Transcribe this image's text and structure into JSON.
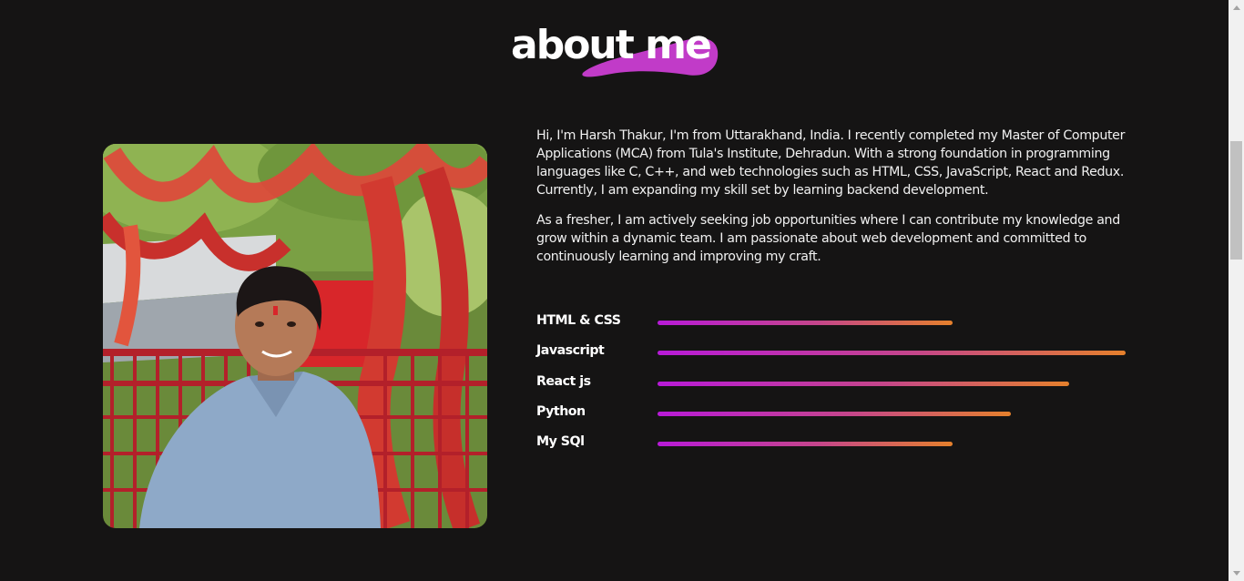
{
  "heading": {
    "text": "about me",
    "accent_color": "#c13bc8"
  },
  "photo": {
    "icon": "profile-photo"
  },
  "bio": {
    "paragraphs": [
      "Hi, I'm Harsh Thakur, I'm from Uttarakhand, India. I recently completed my Master of Computer Applications (MCA) from Tula's Institute, Dehradun. With a strong foundation in programming languages like C, C++, and web technologies such as HTML, CSS, JavaScript, React and Redux. Currently, I am expanding my skill set by learning backend development.",
      "As a fresher, I am actively seeking job opportunities where I can contribute my knowledge and grow within a dynamic team. I am passionate about web development and committed to continuously learning and improving my craft."
    ]
  },
  "skills": [
    {
      "label": "HTML & CSS",
      "level": 0.63
    },
    {
      "label": "Javascript",
      "level": 1.0
    },
    {
      "label": "React js",
      "level": 0.88
    },
    {
      "label": "Python",
      "level": 0.755
    },
    {
      "label": "My SQl",
      "level": 0.63
    }
  ],
  "colors": {
    "background": "#151414",
    "gradient_start": "#b81ad8",
    "gradient_end": "#e5802c"
  }
}
